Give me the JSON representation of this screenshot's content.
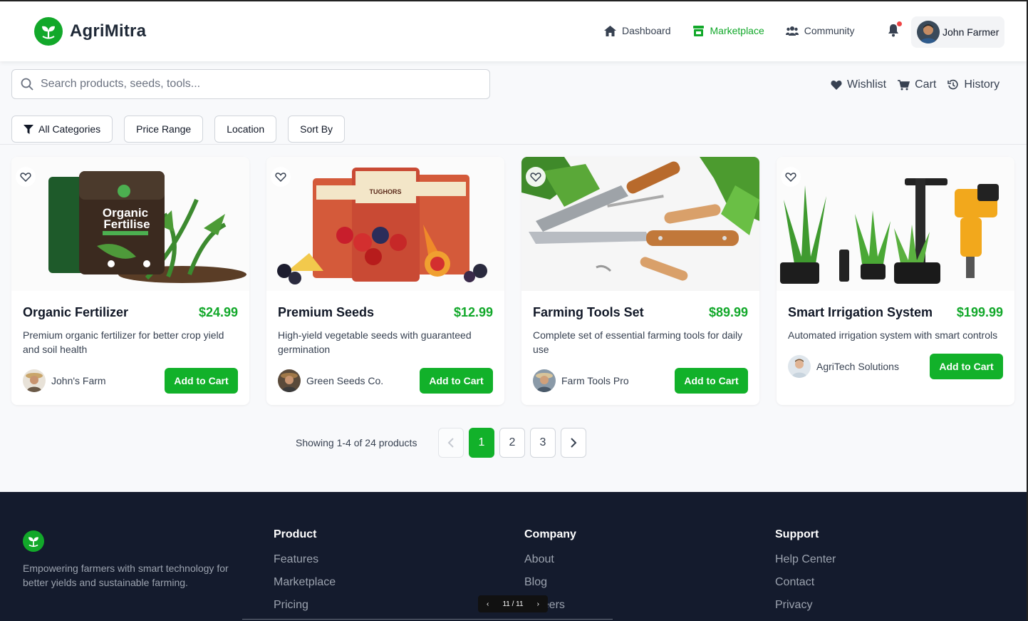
{
  "brand": {
    "name": "AgriMitra",
    "accent": "#12a82a"
  },
  "nav": [
    {
      "label": "Dashboard",
      "icon": "home-icon",
      "active": false
    },
    {
      "label": "Marketplace",
      "icon": "store-icon",
      "active": true
    },
    {
      "label": "Community",
      "icon": "users-icon",
      "active": false
    }
  ],
  "user": {
    "name": "John Farmer"
  },
  "search": {
    "placeholder": "Search products, seeds, tools..."
  },
  "quick_links": [
    {
      "label": "Wishlist",
      "icon": "heart-icon"
    },
    {
      "label": "Cart",
      "icon": "cart-icon"
    },
    {
      "label": "History",
      "icon": "history-icon"
    }
  ],
  "filters": [
    "All Categories",
    "Price Range",
    "Location",
    "Sort By"
  ],
  "products": [
    {
      "name": "Organic Fertilizer",
      "price": "$24.99",
      "description": "Premium organic fertilizer for better crop yield and soil health",
      "seller": "John's Farm",
      "button": "Add to Cart",
      "image_text": [
        "Organic",
        "Fertilise"
      ]
    },
    {
      "name": "Premium Seeds",
      "price": "$12.99",
      "description": "High-yield vegetable seeds with guaranteed germination",
      "seller": "Green Seeds Co.",
      "button": "Add to Cart",
      "image_text": [
        "TUGHORS"
      ]
    },
    {
      "name": "Farming Tools Set",
      "price": "$89.99",
      "description": "Complete set of essential farming tools for daily use",
      "seller": "Farm Tools Pro",
      "button": "Add to Cart"
    },
    {
      "name": "Smart Irrigation System",
      "price": "$199.99",
      "description": "Automated irrigation system with smart controls",
      "seller": "AgriTech Solutions",
      "button": "Add to Cart"
    }
  ],
  "pagination": {
    "showing": "Showing 1-4 of 24 products",
    "pages": [
      "1",
      "2",
      "3"
    ],
    "current": "1"
  },
  "footer": {
    "tagline": "Empowering farmers with smart technology for better yields and sustainable farming.",
    "columns": [
      {
        "title": "Product",
        "links": [
          "Features",
          "Marketplace",
          "Pricing"
        ]
      },
      {
        "title": "Company",
        "links": [
          "About",
          "Blog",
          "Careers"
        ]
      },
      {
        "title": "Support",
        "links": [
          "Help Center",
          "Contact",
          "Privacy"
        ]
      }
    ]
  },
  "slide_indicator": "11 / 11"
}
